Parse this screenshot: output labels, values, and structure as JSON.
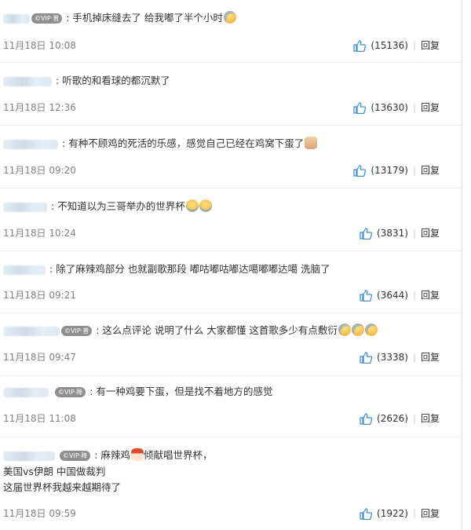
{
  "comments": [
    {
      "badge": "©VIP·普",
      "text": "手机掉床缝去了 给我嘟了半个小时",
      "emojis": [
        "sweat-smile"
      ],
      "date": "11月18日 10:08",
      "likes": "(15136)",
      "reply": "回复"
    },
    {
      "badge": "",
      "text": "听歌的和看球的都沉默了",
      "emojis": [],
      "date": "11月18日 12:36",
      "likes": "(13630)",
      "reply": "回复"
    },
    {
      "badge": "",
      "text": "有种不顾鸡的死活的乐感，感觉自己已经在鸡窝下蛋了",
      "emojis": [
        "thumbs-up"
      ],
      "date": "11月18日 09:20",
      "likes": "(13179)",
      "reply": "回复"
    },
    {
      "badge": "",
      "text": "不知道以为三哥举办的世界杯",
      "emojis": [
        "laugh-cry",
        "laugh-cry"
      ],
      "date": "11月18日 10:24",
      "likes": "(3831)",
      "reply": "回复"
    },
    {
      "badge": "",
      "text": "除了麻辣鸡部分 也就副歌那段 嘟咕嘟咕嘟达噶嘟嘟达噶 洗脑了",
      "emojis": [],
      "date": "11月18日 09:21",
      "likes": "(3644)",
      "reply": "回复"
    },
    {
      "badge": "©VIP·普",
      "text": "这么点评论 说明了什么 大家都懂 这首歌多少有点敷衍",
      "emojis": [
        "sweat",
        "sweat",
        "sweat"
      ],
      "date": "11月18日 09:47",
      "likes": "(3338)",
      "reply": "回复"
    },
    {
      "badge": "©VIP·降",
      "text": "有一种鸡要下蛋，但是找不着地方的感觉",
      "emojis": [],
      "date": "11月18日 11:08",
      "likes": "(2626)",
      "reply": "回复"
    },
    {
      "badge": "©VIP·降",
      "text": "麻辣鸡",
      "emojis": [
        "rooster"
      ],
      "text_tail": "倾献唱世界杯，",
      "extra_lines": [
        "美国vs伊朗 中国做裁判",
        "这届世界杯我越来越期待了"
      ],
      "date": "11月18日 09:59",
      "likes": "(1922)",
      "reply": "回复"
    }
  ],
  "colors": {
    "like_icon": "#3a8ad8",
    "date": "#808080",
    "badge": "#8f8f8f",
    "divider": "#eeeeee"
  }
}
